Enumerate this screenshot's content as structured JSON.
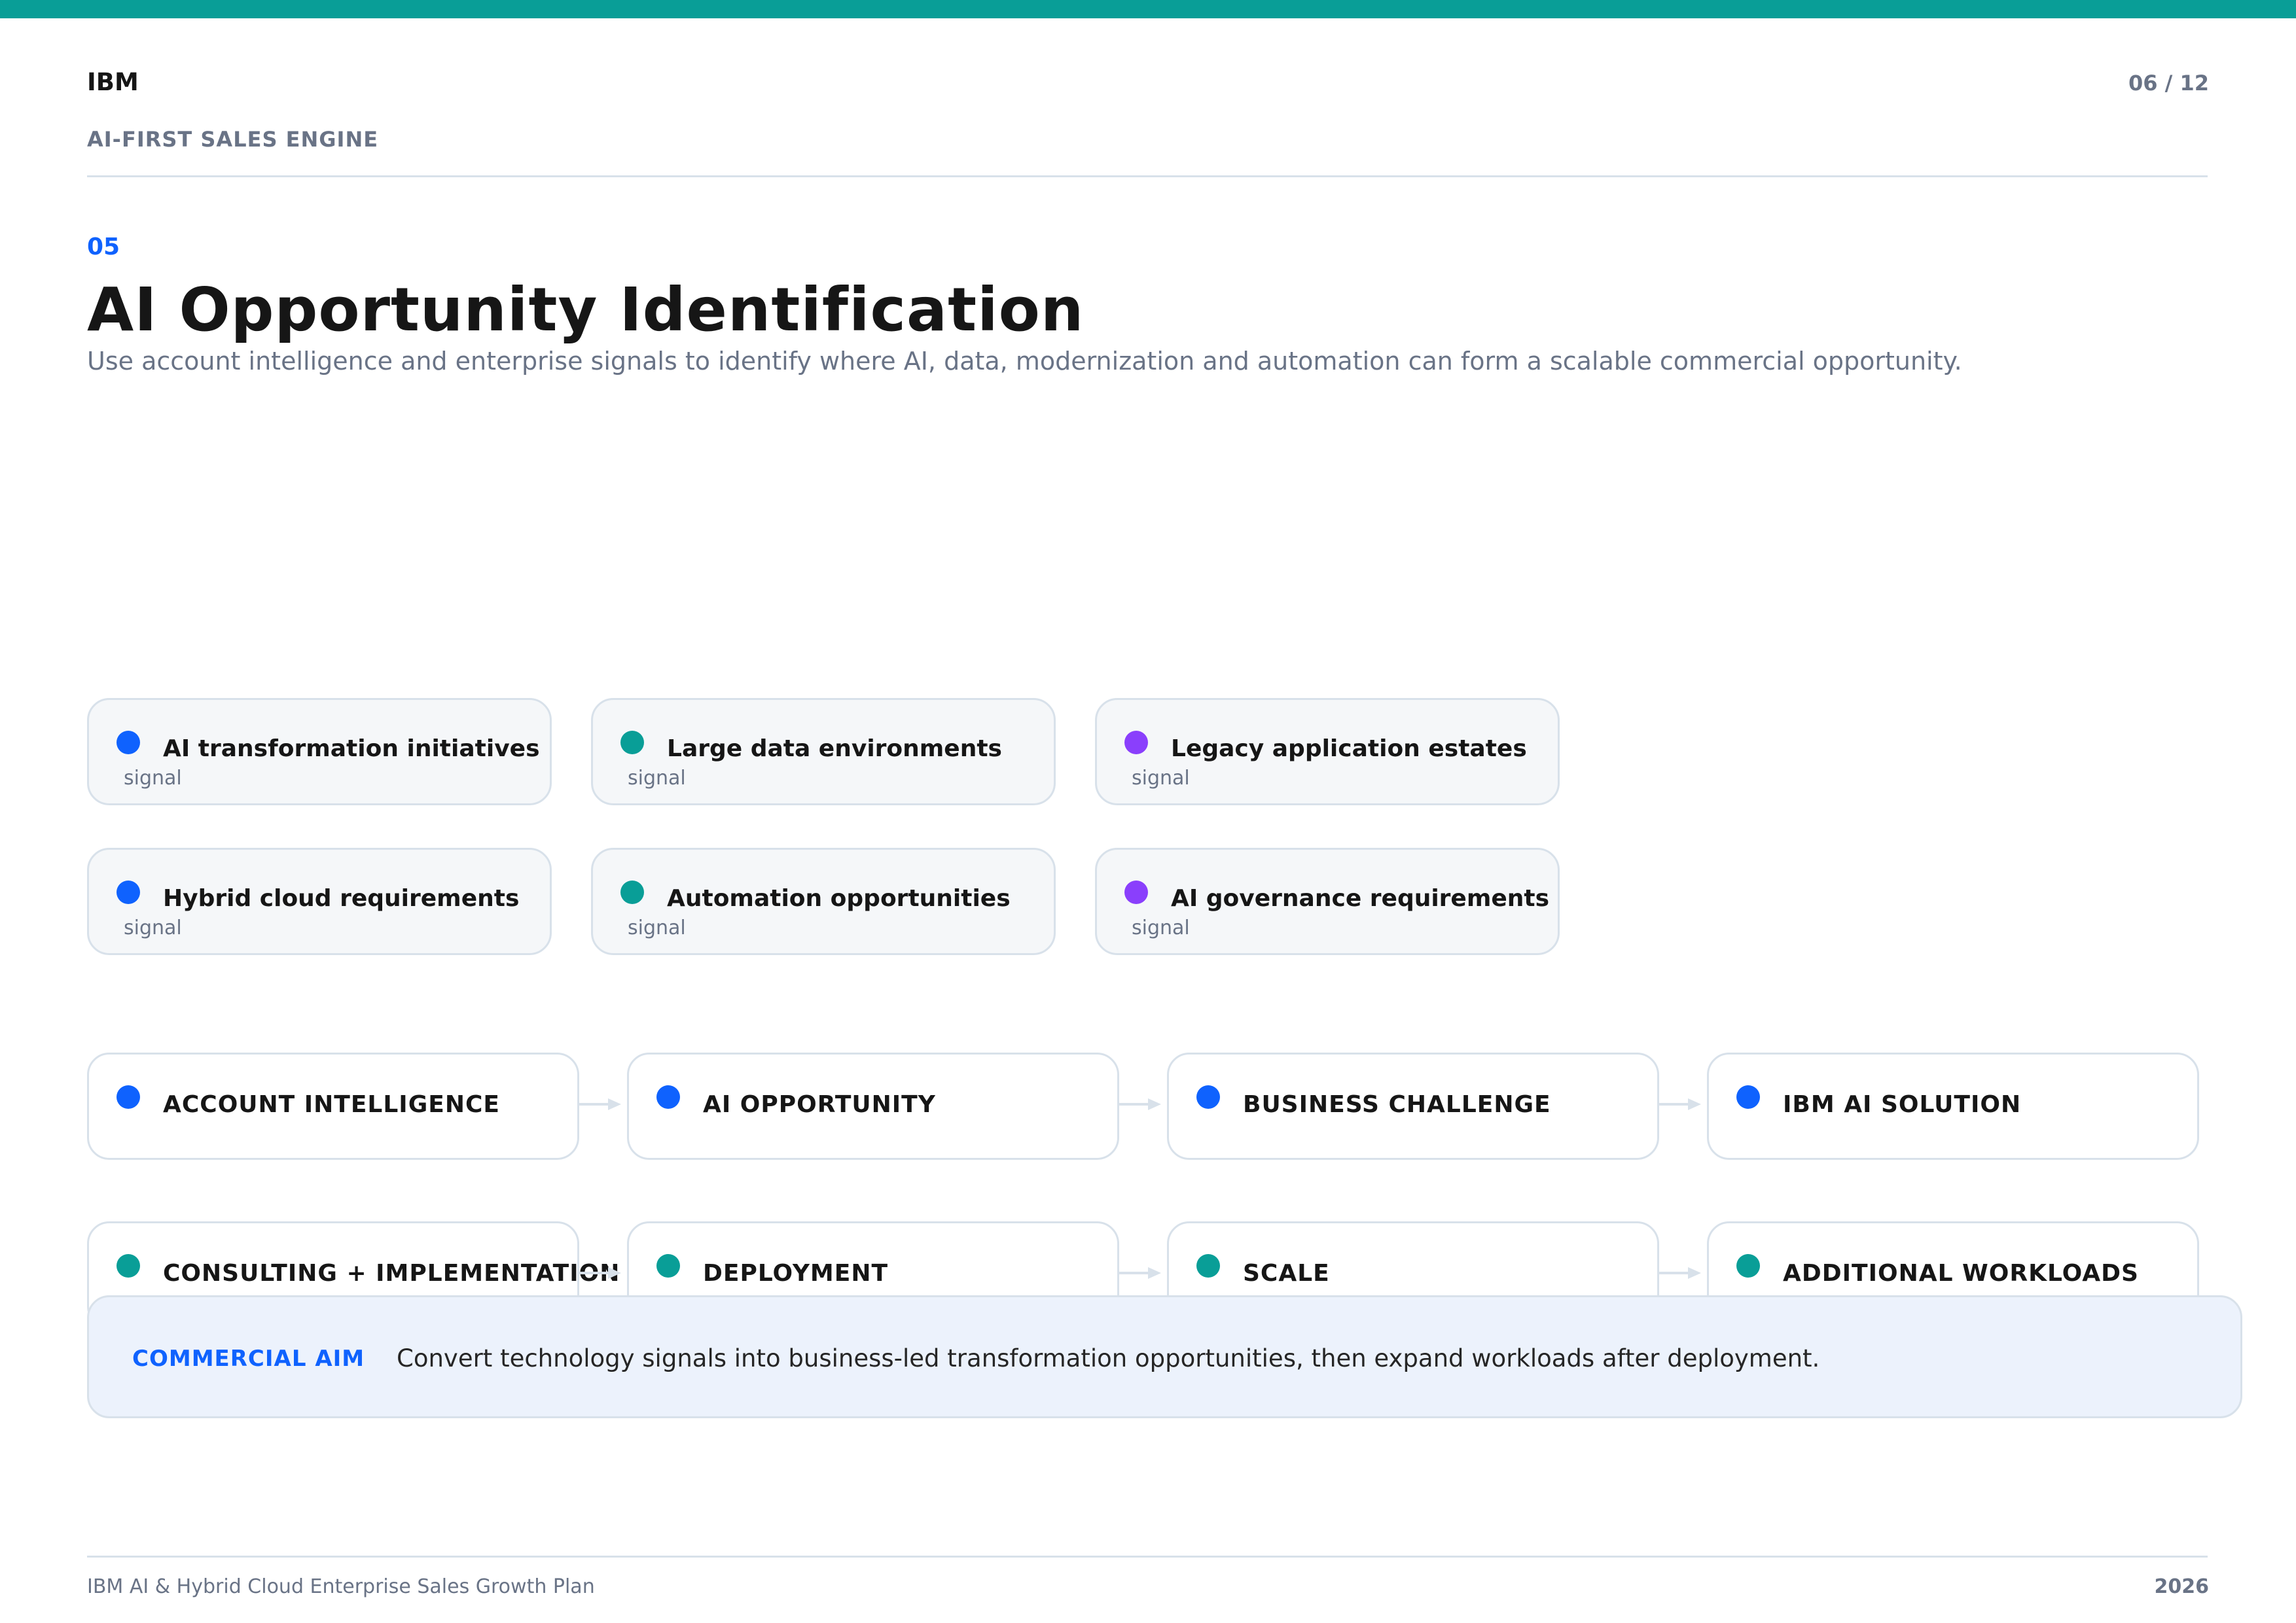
{
  "header": {
    "brand": "IBM",
    "deck_title": "AI-FIRST SALES ENGINE",
    "page_number": "06 / 12"
  },
  "section": {
    "number": "05",
    "title": "AI Opportunity Identification",
    "subtitle": "Use account intelligence and enterprise signals to identify where AI, data, modernization and automation can form a scalable commercial opportunity."
  },
  "signals": [
    {
      "label": "AI transformation initiatives",
      "sub": "signal",
      "color": "#0f62fe"
    },
    {
      "label": "Large data environments",
      "sub": "signal",
      "color": "#099e97"
    },
    {
      "label": "Legacy application estates",
      "sub": "signal",
      "color": "#8a3ffc"
    },
    {
      "label": "Hybrid cloud requirements",
      "sub": "signal",
      "color": "#0f62fe"
    },
    {
      "label": "Automation opportunities",
      "sub": "signal",
      "color": "#099e97"
    },
    {
      "label": "AI governance requirements",
      "sub": "signal",
      "color": "#8a3ffc"
    }
  ],
  "flow_row_1": [
    {
      "label": "ACCOUNT INTELLIGENCE",
      "color": "#0f62fe"
    },
    {
      "label": "AI OPPORTUNITY",
      "color": "#0f62fe"
    },
    {
      "label": "BUSINESS CHALLENGE",
      "color": "#0f62fe"
    },
    {
      "label": "IBM AI SOLUTION",
      "color": "#0f62fe"
    }
  ],
  "flow_row_2": [
    {
      "label": "CONSULTING + IMPLEMENTATION",
      "color": "#099e97"
    },
    {
      "label": "DEPLOYMENT",
      "color": "#099e97"
    },
    {
      "label": "SCALE",
      "color": "#099e97"
    },
    {
      "label": "ADDITIONAL WORKLOADS",
      "color": "#099e97"
    }
  ],
  "commercial_aim": {
    "label": "COMMERCIAL AIM",
    "text": "Convert technology signals into business-led transformation opportunities, then expand workloads after deployment."
  },
  "footer": {
    "left": "IBM AI & Hybrid Cloud Enterprise Sales Growth Plan",
    "right": "2026"
  }
}
